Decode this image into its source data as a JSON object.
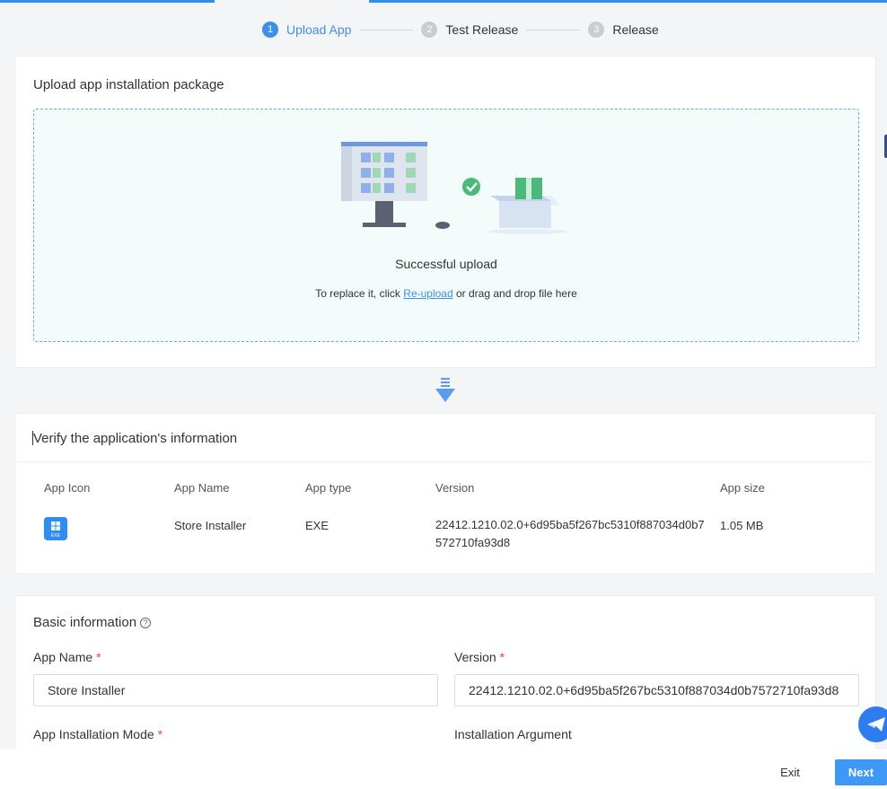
{
  "steps": [
    {
      "num": "1",
      "label": "Upload App"
    },
    {
      "num": "2",
      "label": "Test Release"
    },
    {
      "num": "3",
      "label": "Release"
    }
  ],
  "upload": {
    "title": "Upload app installation package",
    "success": "Successful upload",
    "replace_prefix": "To replace it, click ",
    "replace_link": "Re-upload",
    "replace_suffix": " or drag and drop file here"
  },
  "verify": {
    "title": "Verify the application's information",
    "columns": [
      "App Icon",
      "App Name",
      "App type",
      "Version",
      "App size"
    ],
    "row": {
      "icon_label": "EXE",
      "name": "Store Installer",
      "type": "EXE",
      "version": "22412.1210.02.0+6d95ba5f267bc5310f887034d0b7572710fa93d8",
      "size": "1.05 MB"
    }
  },
  "basic": {
    "title": "Basic information",
    "help": "?",
    "app_name_label": "App Name",
    "app_name_value": "Store Installer",
    "version_label": "Version",
    "version_value": "22412.1210.02.0+6d95ba5f267bc5310f887034d0b7572710fa93d8",
    "install_mode_label": "App Installation Mode",
    "install_arg_label": "Installation Argument",
    "required_mark": "*"
  },
  "footer": {
    "exit": "Exit",
    "next": "Next"
  },
  "colors": {
    "accent": "#3d8fe8",
    "success": "#4cb87a",
    "dropzone_border": "#5fb7c4"
  }
}
